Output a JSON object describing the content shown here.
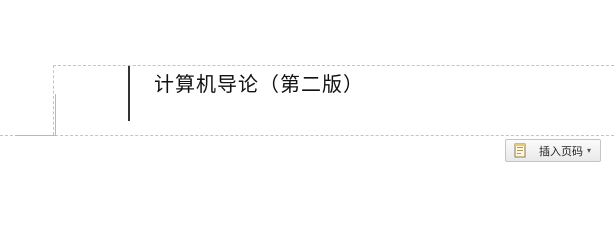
{
  "document": {
    "header_text": "计算机导论（第二版）"
  },
  "toolbar": {
    "insert_page_number_label": "插入页码",
    "dropdown_arrow": "▾"
  },
  "icons": {
    "page_icon": "page-number-icon"
  }
}
